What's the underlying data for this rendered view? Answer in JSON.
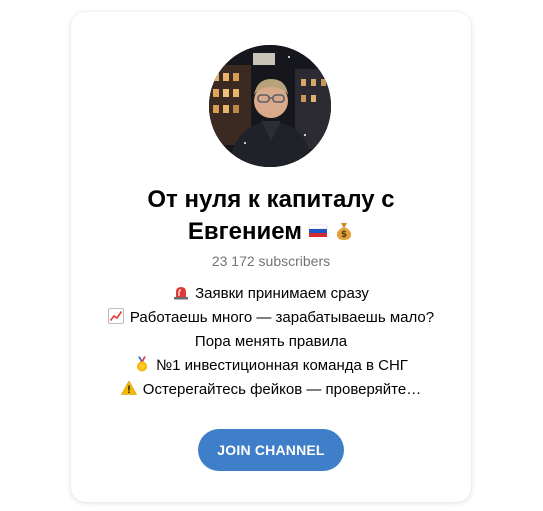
{
  "channel": {
    "title_line1": "От нуля к капиталу с",
    "title_line2": "Евгением",
    "title_emojis": [
      "russia-flag-icon",
      "money-bag-icon"
    ],
    "subscribers": "23 172 subscribers",
    "description": [
      {
        "icon": "siren-icon",
        "text": "Заявки принимаем сразу"
      },
      {
        "icon": "chart-increasing-icon",
        "text": "Работаешь много — зарабатываешь мало?"
      },
      {
        "icon": "",
        "text": "Пора менять правила"
      },
      {
        "icon": "medal-icon",
        "text": "№1 инвестиционная команда в СНГ"
      },
      {
        "icon": "warning-icon",
        "text": "Остерегайтесь фейков — проверяйте…"
      }
    ],
    "join_label": "JOIN CHANNEL"
  },
  "colors": {
    "accent": "#3f7ec8",
    "muted_text": "#707579",
    "text": "#000000",
    "background": "#ffffff"
  }
}
